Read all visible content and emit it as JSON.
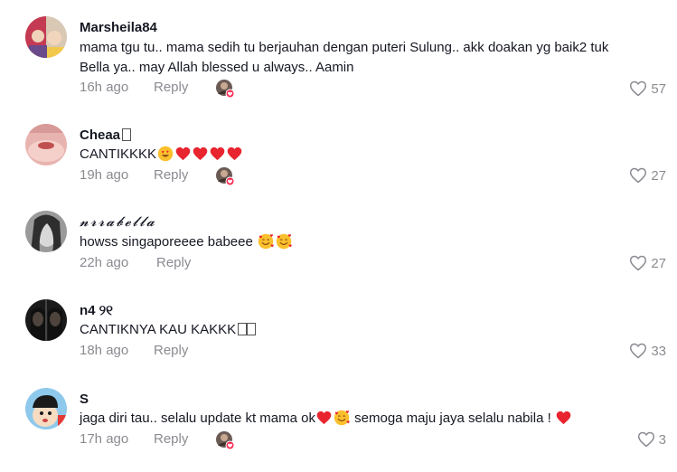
{
  "comments": [
    {
      "username": "Marsheila84",
      "text_line1": "mama tgu tu.. mama sedih tu berjauhan dengan puteri Sulung.. akk doakan yg baik2 tuk",
      "text_line2": "Bella ya.. may Allah blessed u always.. Aamin",
      "time": "16h ago",
      "reply": "Reply",
      "likes": "57"
    },
    {
      "username": "Cheaa",
      "text": "CANTIKKKK",
      "time": "19h ago",
      "reply": "Reply",
      "likes": "27"
    },
    {
      "username": "𝓷𝓻𝓻𝓪𝓫𝓮𝓵𝓵𝓪",
      "text": "howss singaporeeee babeee",
      "time": "22h ago",
      "reply": "Reply",
      "likes": "27"
    },
    {
      "username": "n4 ୨୧",
      "text": "CANTIKNYA KAU KAKKK",
      "time": "18h ago",
      "reply": "Reply",
      "likes": "33"
    },
    {
      "username": "S",
      "text_part1": "jaga diri tau.. selalu update kt mama ok",
      "text_part2": " semoga maju jaya selalu nabila ! ",
      "time": "17h ago",
      "reply": "Reply",
      "likes": "3"
    }
  ],
  "colors": {
    "text": "#161823",
    "muted": "#8a8b91",
    "heart": "#e8242f",
    "creator_badge": "#fe2c55"
  },
  "icons": {
    "like": "heart-outline-icon",
    "creator_liked": "creator-liked-avatar-icon"
  }
}
